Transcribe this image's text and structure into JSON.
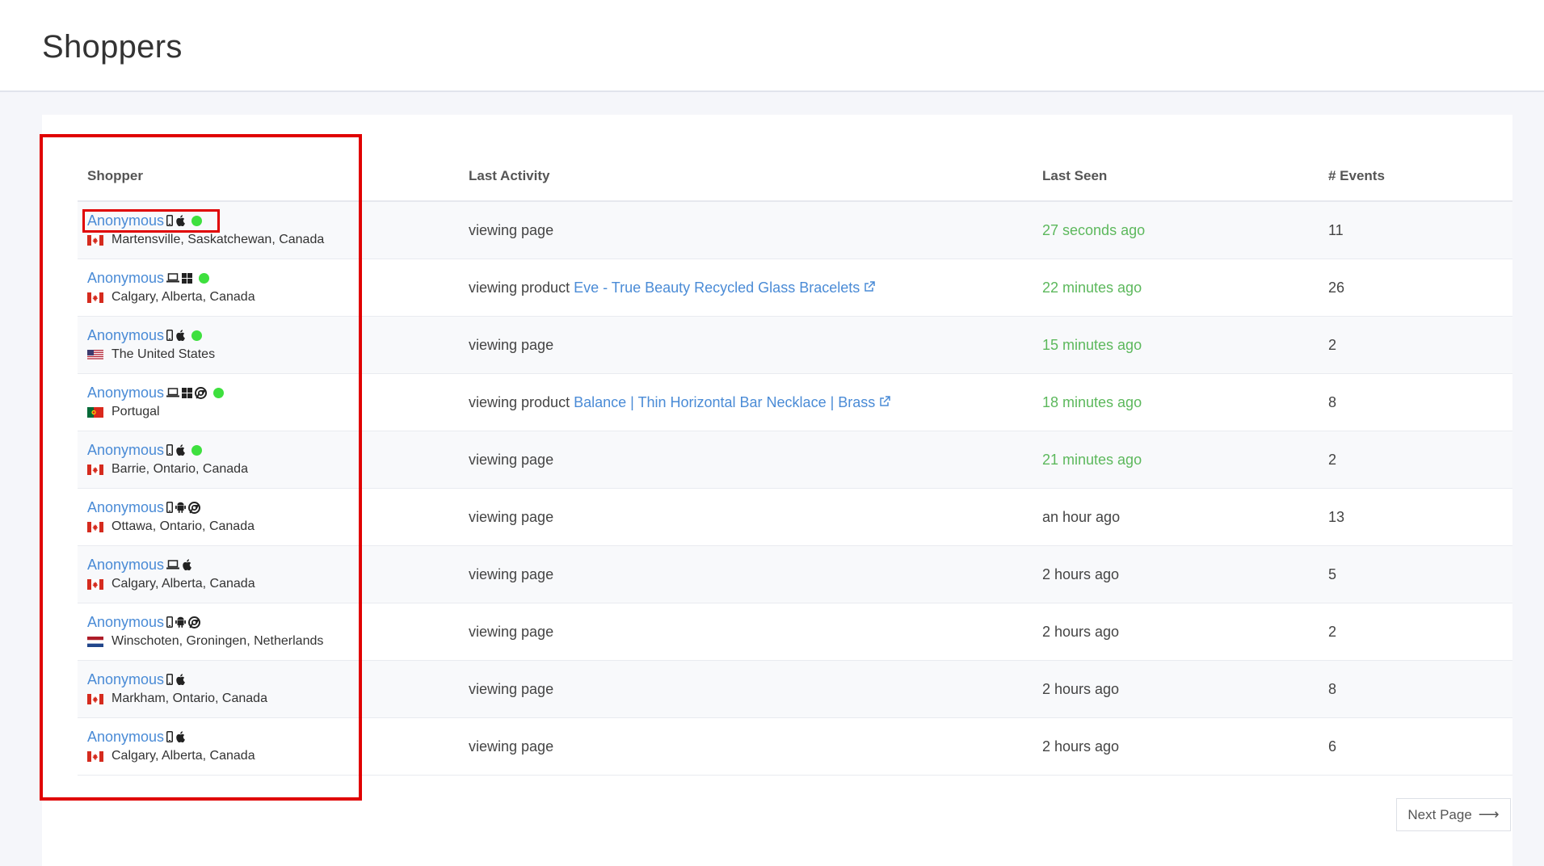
{
  "page": {
    "title": "Shoppers"
  },
  "table": {
    "headers": [
      "Shopper",
      "Last Activity",
      "Last Seen",
      "# Events"
    ],
    "rows": [
      {
        "name": "Anonymous",
        "device": "phone",
        "os": "apple",
        "browser": "",
        "online": true,
        "flag": "ca",
        "location": "Martensville, Saskatchewan, Canada",
        "activity": "viewing page",
        "product": "",
        "last_seen": "27 seconds ago",
        "recent": true,
        "events": "11"
      },
      {
        "name": "Anonymous",
        "device": "laptop",
        "os": "windows",
        "browser": "",
        "online": true,
        "flag": "ca",
        "location": "Calgary, Alberta, Canada",
        "activity": "viewing product",
        "product": "Eve - True Beauty Recycled Glass Bracelets",
        "last_seen": "22 minutes ago",
        "recent": true,
        "events": "26"
      },
      {
        "name": "Anonymous",
        "device": "phone",
        "os": "apple",
        "browser": "",
        "online": true,
        "flag": "us",
        "location": "The United States",
        "activity": "viewing page",
        "product": "",
        "last_seen": "15 minutes ago",
        "recent": true,
        "events": "2"
      },
      {
        "name": "Anonymous",
        "device": "laptop",
        "os": "windows",
        "browser": "chrome",
        "online": true,
        "flag": "pt",
        "location": "Portugal",
        "activity": "viewing product",
        "product": "Balance | Thin Horizontal Bar Necklace | Brass",
        "last_seen": "18 minutes ago",
        "recent": true,
        "events": "8"
      },
      {
        "name": "Anonymous",
        "device": "phone",
        "os": "apple",
        "browser": "",
        "online": true,
        "flag": "ca",
        "location": "Barrie, Ontario, Canada",
        "activity": "viewing page",
        "product": "",
        "last_seen": "21 minutes ago",
        "recent": true,
        "events": "2"
      },
      {
        "name": "Anonymous",
        "device": "phone",
        "os": "android",
        "browser": "chrome",
        "online": false,
        "flag": "ca",
        "location": "Ottawa, Ontario, Canada",
        "activity": "viewing page",
        "product": "",
        "last_seen": "an hour ago",
        "recent": false,
        "events": "13"
      },
      {
        "name": "Anonymous",
        "device": "laptop",
        "os": "apple",
        "browser": "",
        "online": false,
        "flag": "ca",
        "location": "Calgary, Alberta, Canada",
        "activity": "viewing page",
        "product": "",
        "last_seen": "2 hours ago",
        "recent": false,
        "events": "5"
      },
      {
        "name": "Anonymous",
        "device": "phone",
        "os": "android",
        "browser": "chrome",
        "online": false,
        "flag": "nl",
        "location": "Winschoten, Groningen, Netherlands",
        "activity": "viewing page",
        "product": "",
        "last_seen": "2 hours ago",
        "recent": false,
        "events": "2"
      },
      {
        "name": "Anonymous",
        "device": "phone",
        "os": "apple",
        "browser": "",
        "online": false,
        "flag": "ca",
        "location": "Markham, Ontario, Canada",
        "activity": "viewing page",
        "product": "",
        "last_seen": "2 hours ago",
        "recent": false,
        "events": "8"
      },
      {
        "name": "Anonymous",
        "device": "phone",
        "os": "apple",
        "browser": "",
        "online": false,
        "flag": "ca",
        "location": "Calgary, Alberta, Canada",
        "activity": "viewing page",
        "product": "",
        "last_seen": "2 hours ago",
        "recent": false,
        "events": "6"
      }
    ]
  },
  "pagination": {
    "next_label": "Next Page"
  },
  "colors": {
    "link": "#4a8bd6",
    "recent": "#5cb85c",
    "online": "#3ee03e",
    "highlight": "#e00000"
  }
}
